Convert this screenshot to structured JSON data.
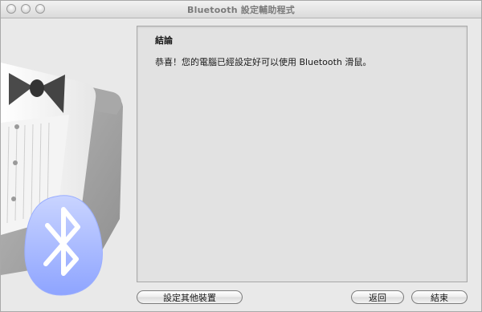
{
  "window": {
    "title": "Bluetooth 設定輔助程式"
  },
  "content": {
    "heading": "結論",
    "message": "恭喜！您的電腦已經設定好可以使用 Bluetooth 滑鼠。"
  },
  "buttons": {
    "setup_another": "設定其他裝置",
    "back": "返回",
    "done": "結束"
  },
  "icons": {
    "illustration": "bluetooth-tuxedo-illustration",
    "bluetooth": "bluetooth-icon"
  },
  "colors": {
    "bluetooth_blue": "#9fb3ff",
    "panel_bg": "#e2e2e2",
    "window_bg": "#e9e9e9"
  }
}
